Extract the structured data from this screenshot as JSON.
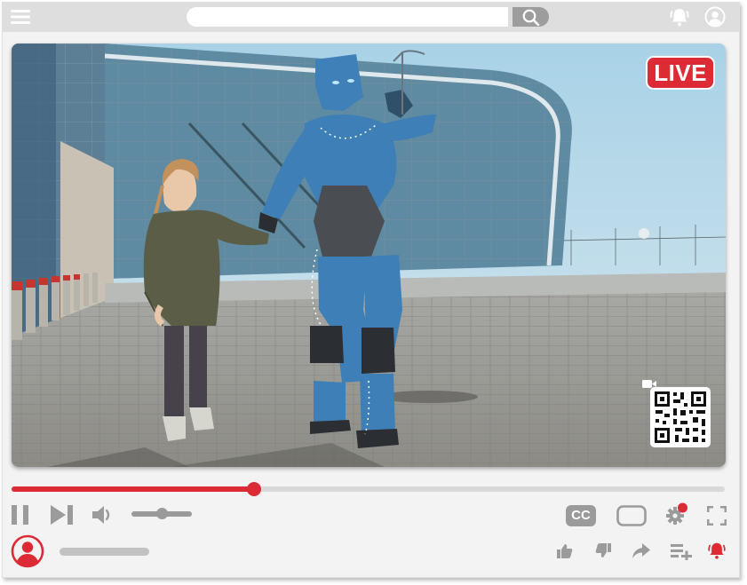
{
  "header": {
    "menu_icon": "hamburger-menu-icon",
    "search": {
      "value": "",
      "placeholder": "",
      "icon": "search-icon"
    },
    "notifications_icon": "bell-icon",
    "account_icon": "user-circle-icon"
  },
  "video": {
    "live_label": "LIVE",
    "qr_icon": "qr-code-icon",
    "camera_icon": "video-camera-icon"
  },
  "player": {
    "progress_fraction": 0.34,
    "volume_fraction": 0.5,
    "controls": {
      "pause_icon": "pause-icon",
      "next_icon": "skip-next-icon",
      "volume_icon": "volume-icon",
      "cc_label": "CC",
      "miniplayer_icon": "miniplayer-icon",
      "settings_icon": "settings-gear-icon",
      "fullscreen_icon": "fullscreen-icon"
    }
  },
  "footer": {
    "channel_avatar_icon": "channel-avatar-icon",
    "actions": [
      "thumbs-up-icon",
      "thumbs-down-icon",
      "share-icon",
      "add-to-playlist-icon",
      "subscribe-bell-icon"
    ]
  },
  "colors": {
    "accent_red": "#dc2b35",
    "topbar_gray": "#dedede",
    "control_gray": "#9b9b9b",
    "frame_bg": "#f3f3f3"
  }
}
